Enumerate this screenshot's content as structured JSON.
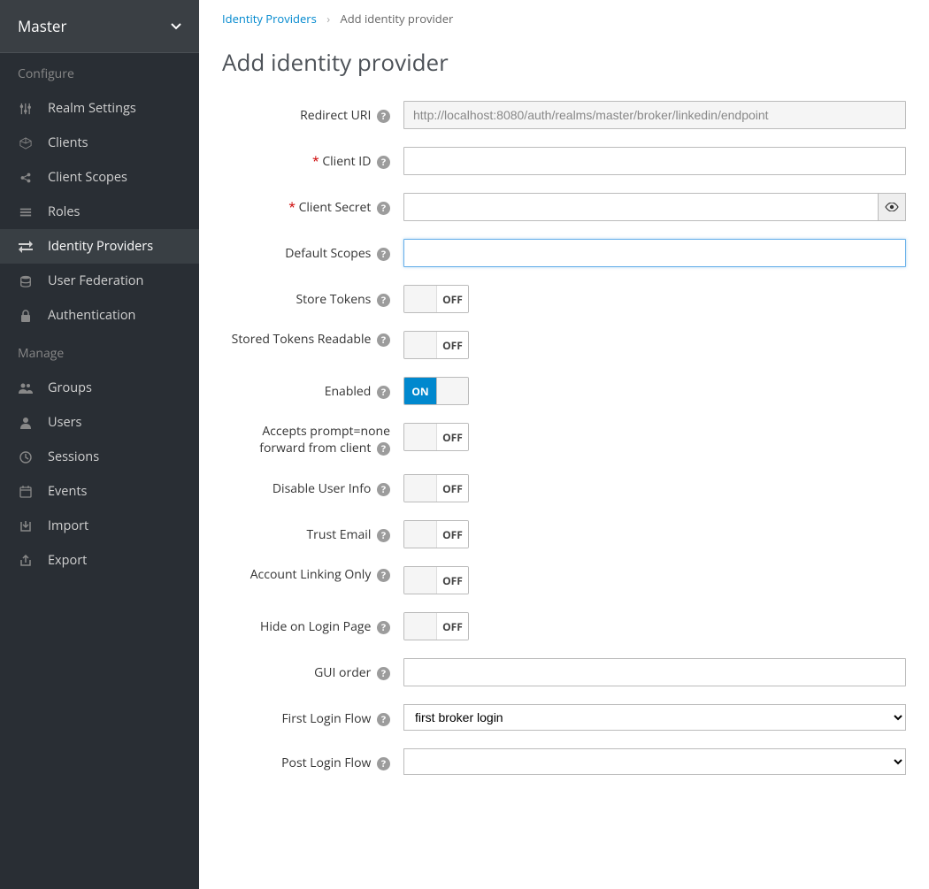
{
  "realm": "Master",
  "sidebar": {
    "configure_header": "Configure",
    "manage_header": "Manage",
    "configure_items": [
      {
        "label": "Realm Settings"
      },
      {
        "label": "Clients"
      },
      {
        "label": "Client Scopes"
      },
      {
        "label": "Roles"
      },
      {
        "label": "Identity Providers"
      },
      {
        "label": "User Federation"
      },
      {
        "label": "Authentication"
      }
    ],
    "manage_items": [
      {
        "label": "Groups"
      },
      {
        "label": "Users"
      },
      {
        "label": "Sessions"
      },
      {
        "label": "Events"
      },
      {
        "label": "Import"
      },
      {
        "label": "Export"
      }
    ]
  },
  "breadcrumb": {
    "parent": "Identity Providers",
    "current": "Add identity provider"
  },
  "page_title": "Add identity provider",
  "form": {
    "redirect_uri": {
      "label": "Redirect URI",
      "value": "http://localhost:8080/auth/realms/master/broker/linkedin/endpoint"
    },
    "client_id": {
      "label": "Client ID",
      "value": "",
      "required": true
    },
    "client_secret": {
      "label": "Client Secret",
      "value": "",
      "required": true
    },
    "default_scopes": {
      "label": "Default Scopes",
      "value": ""
    },
    "store_tokens": {
      "label": "Store Tokens",
      "state": "OFF"
    },
    "stored_tokens_readable": {
      "label": "Stored Tokens Readable",
      "state": "OFF"
    },
    "enabled": {
      "label": "Enabled",
      "state": "ON"
    },
    "accepts_prompt": {
      "label": "Accepts prompt=none forward from client",
      "state": "OFF"
    },
    "disable_user_info": {
      "label": "Disable User Info",
      "state": "OFF"
    },
    "trust_email": {
      "label": "Trust Email",
      "state": "OFF"
    },
    "account_linking_only": {
      "label": "Account Linking Only",
      "state": "OFF"
    },
    "hide_on_login": {
      "label": "Hide on Login Page",
      "state": "OFF"
    },
    "gui_order": {
      "label": "GUI order",
      "value": ""
    },
    "first_login_flow": {
      "label": "First Login Flow",
      "value": "first broker login"
    },
    "post_login_flow": {
      "label": "Post Login Flow",
      "value": ""
    }
  },
  "toggle_labels": {
    "on": "ON",
    "off": "OFF"
  }
}
